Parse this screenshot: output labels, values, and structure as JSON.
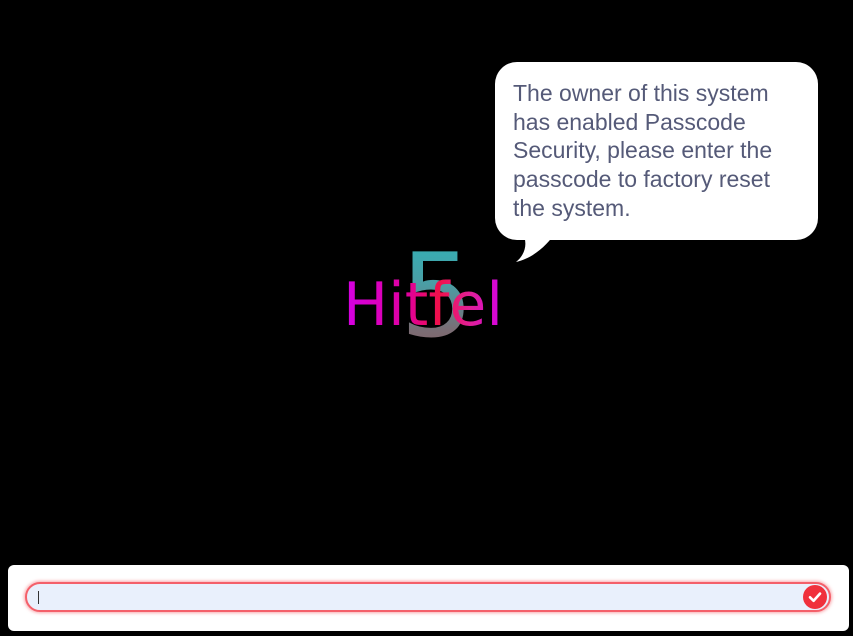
{
  "dialog": {
    "message": "The owner of this system has enabled Passcode Security, please enter the passcode to factory reset the system."
  },
  "logo": {
    "word": "Hitfel",
    "number": "5"
  },
  "passcode": {
    "value": "",
    "placeholder": ""
  },
  "icons": {
    "submit": "check-circle-icon"
  },
  "colors": {
    "background": "#000000",
    "bubble": "#ffffff",
    "bubble_text": "#555a78",
    "input_border": "#f4606a",
    "input_fill": "#e9f0fc",
    "submit": "#f0303c"
  }
}
